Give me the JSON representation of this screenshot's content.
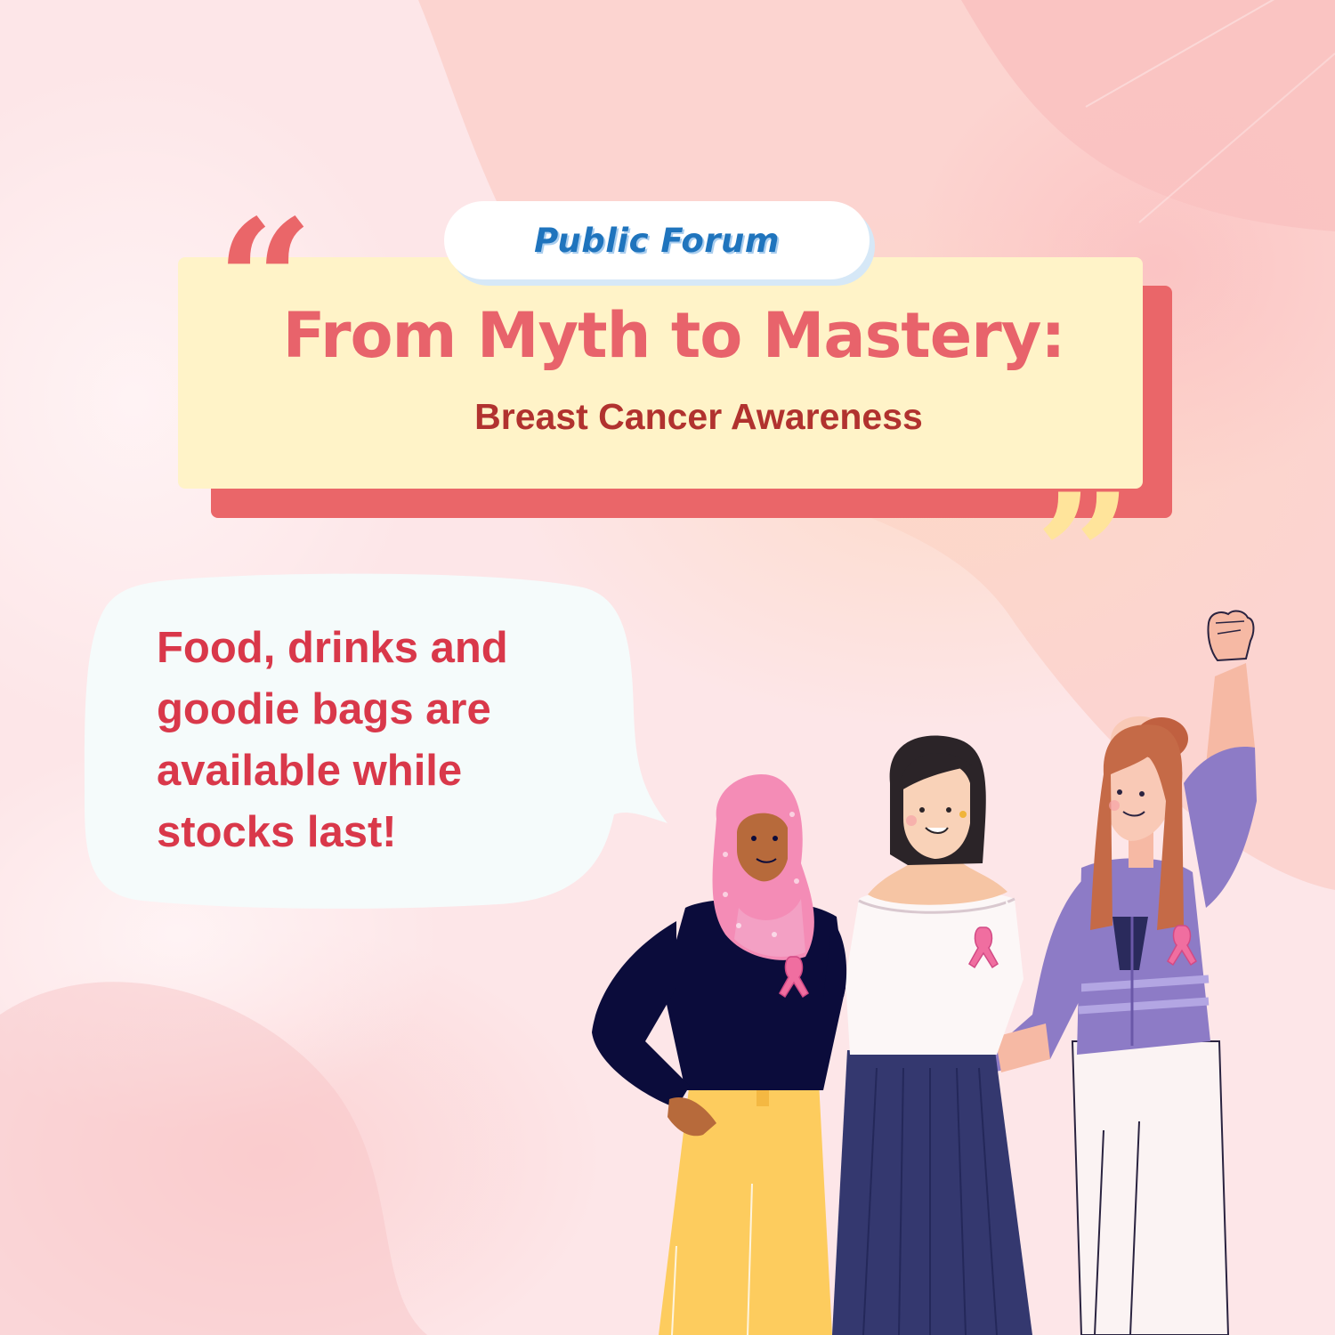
{
  "event": {
    "tag": "Public Forum",
    "title": "From Myth to Mastery:",
    "subtitle": "Breast Cancer Awareness"
  },
  "quotes": {
    "open": "“",
    "close": "”"
  },
  "bubble": {
    "lines": [
      "Food, drinks and",
      "goodie bags are",
      "available while",
      "stocks last!"
    ]
  },
  "illustration": {
    "people": [
      "woman-in-hijab",
      "woman-in-white-top",
      "woman-in-purple-cardigan"
    ],
    "icons": [
      "pink-ribbon-icon"
    ]
  },
  "colors": {
    "background": "#fde4e6",
    "accent_red": "#ea6669",
    "card_yellow": "#fff3c8",
    "tag_blue": "#1f74bd",
    "bubble_text": "#d9384a",
    "ribbon_pink": "#f06ea0"
  }
}
